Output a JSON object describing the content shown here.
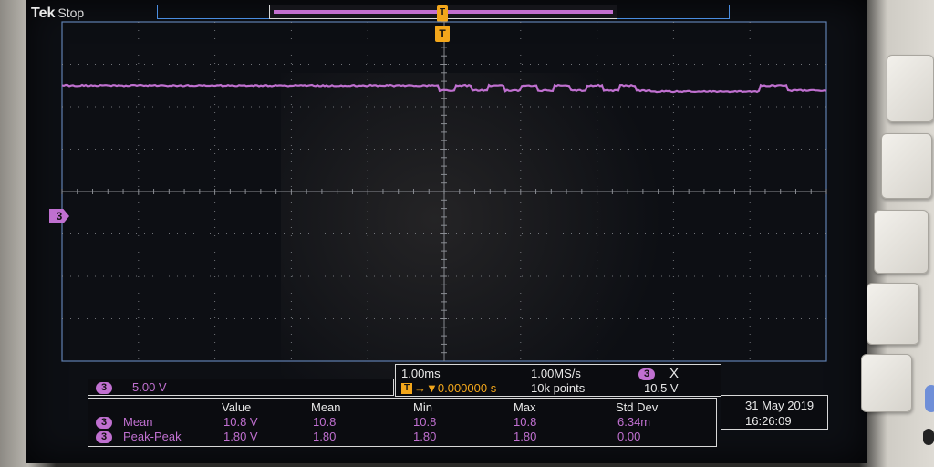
{
  "header": {
    "brand": "Tek",
    "run_state": "Stop"
  },
  "markers": {
    "trigger": "T",
    "channel": "3"
  },
  "waveform": {
    "color": "#c070d0",
    "level_divisions_above_center": 2.5,
    "dip_depth_divisions": 0.12
  },
  "channel_scale": {
    "channel": "3",
    "value": "5.00 V"
  },
  "timebase": {
    "time_per_div": "1.00ms",
    "sample_rate": "1.00MS/s",
    "trigger_channel": "3",
    "trigger_type_icon": "X",
    "trigger_icon": "T",
    "trigger_position": "→▼0.000000 s",
    "record_length": "10k points",
    "trigger_level": "10.5 V"
  },
  "measurements": {
    "headers": [
      "Value",
      "Mean",
      "Min",
      "Max",
      "Std Dev"
    ],
    "rows": [
      {
        "channel": "3",
        "name": "Mean",
        "values": [
          "10.8 V",
          "10.8",
          "10.8",
          "10.8",
          "6.34m"
        ]
      },
      {
        "channel": "3",
        "name": "Peak-Peak",
        "values": [
          "1.80 V",
          "1.80",
          "1.80",
          "1.80",
          "0.00"
        ]
      }
    ]
  },
  "datetime": {
    "date": "31 May 2019",
    "time": "16:26:09"
  },
  "colors": {
    "channel3": "#c070d0",
    "trigger": "#f2a61b",
    "graticule": "#8a8d93",
    "record_bar": "#4a8de0"
  }
}
